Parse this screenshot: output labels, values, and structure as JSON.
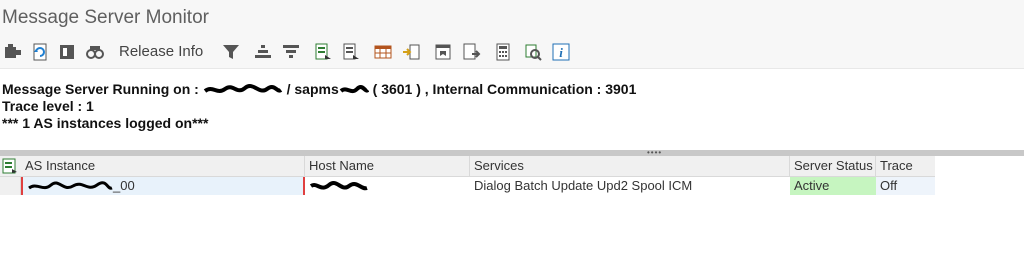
{
  "window": {
    "title": "Message Server Monitor"
  },
  "toolbar": {
    "release_info_label": "Release Info",
    "icons": [
      "refresh-server-icon",
      "reload-icon",
      "server-display-icon",
      "search-binoculars-icon",
      "filter-icon",
      "sort-ascending-icon",
      "sort-descending-icon",
      "export-icon",
      "print-preview-icon",
      "table-view-icon",
      "move-icon",
      "layout-icon",
      "local-file-icon",
      "calculator-icon",
      "find-icon",
      "information-icon"
    ]
  },
  "info": {
    "line1_prefix": "Message Server Running on :",
    "line1_mid": "/ sapms",
    "line1_suffix": "( 3601 ) , Internal Communication : 3901",
    "line2": "Trace level : 1",
    "line3": "*** 1 AS instances logged on***"
  },
  "grid": {
    "columns": [
      "AS Instance",
      "Host Name",
      "Services",
      "Server Status",
      "Trace"
    ],
    "rows": [
      {
        "as_instance_suffix": "_00",
        "services": "Dialog Batch Update Upd2 Spool ICM",
        "server_status": "Active",
        "trace": "Off"
      }
    ]
  },
  "colors": {
    "active_status": "#c6f5c0",
    "selection": "#e8f2fb",
    "focus_marker": "#e04040"
  }
}
